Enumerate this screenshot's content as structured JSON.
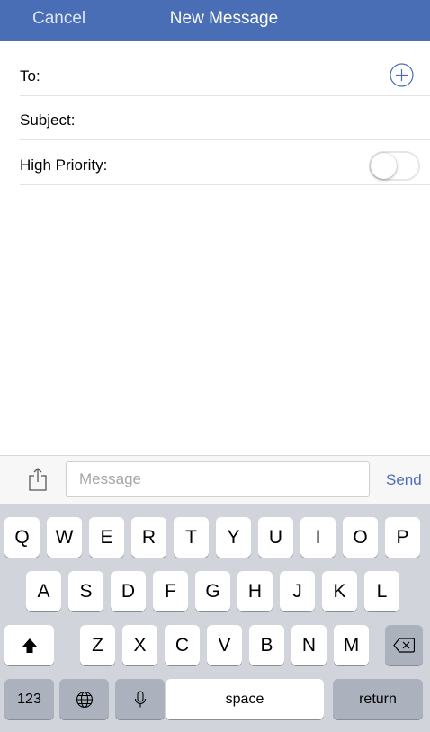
{
  "navbar": {
    "cancel_label": "Cancel",
    "title": "New Message"
  },
  "form": {
    "to_label": "To:",
    "subject_label": "Subject:",
    "priority_label": "High Priority:",
    "priority_on": false
  },
  "composer": {
    "placeholder": "Message",
    "send_label": "Send"
  },
  "keyboard": {
    "row1": [
      "Q",
      "W",
      "E",
      "R",
      "T",
      "Y",
      "U",
      "I",
      "O",
      "P"
    ],
    "row2": [
      "A",
      "S",
      "D",
      "F",
      "G",
      "H",
      "J",
      "K",
      "L"
    ],
    "row3": [
      "Z",
      "X",
      "C",
      "V",
      "B",
      "N",
      "M"
    ],
    "numbers_label": "123",
    "space_label": "space",
    "return_label": "return"
  },
  "colors": {
    "accent": "#4a6eb5",
    "keyboard_bg": "#d1d4da",
    "func_key": "#abb2bd"
  },
  "icons": [
    "add-contact-icon",
    "toggle-switch",
    "share-icon",
    "shift-icon",
    "backspace-icon",
    "globe-icon",
    "microphone-icon"
  ]
}
